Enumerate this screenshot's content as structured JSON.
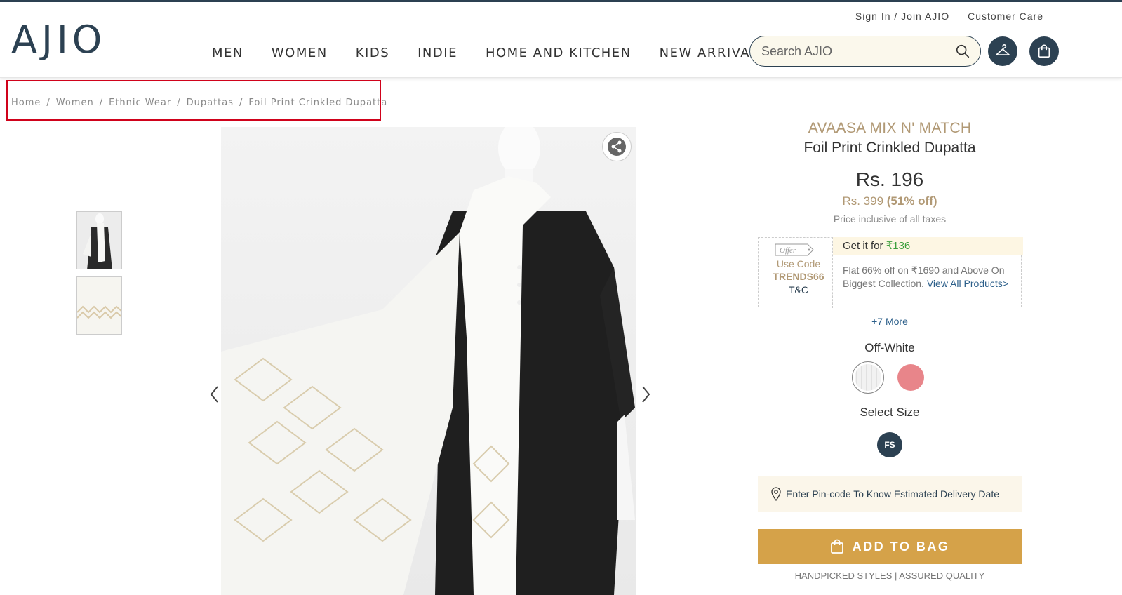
{
  "header": {
    "logo": "AJIO",
    "util_links": {
      "sign_in": "Sign In / Join AJIO",
      "customer_care": "Customer Care"
    },
    "nav": [
      "MEN",
      "WOMEN",
      "KIDS",
      "INDIE",
      "HOME AND KITCHEN",
      "NEW ARRIVALS"
    ],
    "search": {
      "placeholder": "Search AJIO",
      "value": ""
    }
  },
  "breadcrumb": [
    "Home",
    "Women",
    "Ethnic Wear",
    "Dupattas",
    "Foil Print Crinkled Dupatta"
  ],
  "product": {
    "brand": "AVAASA MIX N' MATCH",
    "name": "Foil Print Crinkled Dupatta",
    "price": "Rs. 196",
    "original_price": "Rs. 399",
    "discount": "(51% off)",
    "tax_note": "Price inclusive of all taxes",
    "offer": {
      "tag": "Offer",
      "use_code": "Use Code",
      "code": "TRENDS66",
      "tnc": "T&C",
      "get_it_for": "Get it for ",
      "get_it_amount": "₹136",
      "description": "Flat 66% off on ₹1690 and Above On Biggest Collection. ",
      "view_all": "View All Products>"
    },
    "more_offers": "+7 More",
    "color": "Off-White",
    "size_label": "Select Size",
    "size": "FS",
    "pincode_prompt": "Enter Pin-code To Know Estimated Delivery Date",
    "add_to_bag": "ADD TO BAG",
    "tagline": "HANDPICKED STYLES | ASSURED QUALITY"
  },
  "colors": {
    "brand_dark": "#2c4152",
    "gold": "#d5a249",
    "brand_text": "#b19975",
    "highlight_box": "#d0021b"
  }
}
